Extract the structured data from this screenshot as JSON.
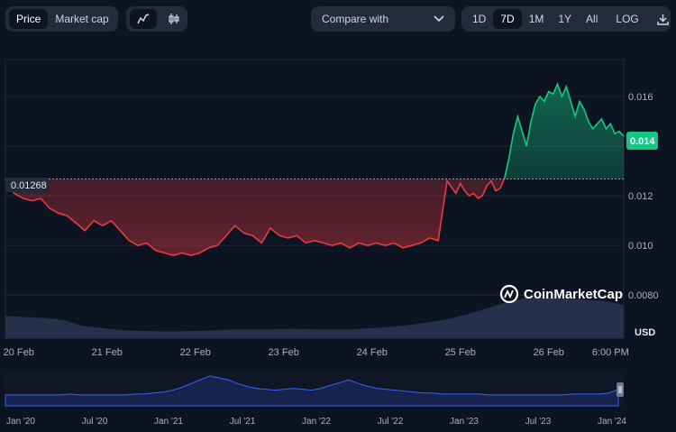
{
  "toolbar": {
    "tabs": [
      {
        "label": "Price",
        "active": true
      },
      {
        "label": "Market cap",
        "active": false
      }
    ],
    "chart_types": [
      "line-chart-icon",
      "candlestick-icon"
    ],
    "compare": {
      "label": "Compare with",
      "icon": "chevron-down-icon"
    },
    "ranges": [
      {
        "label": "1D",
        "active": false
      },
      {
        "label": "7D",
        "active": true
      },
      {
        "label": "1M",
        "active": false
      },
      {
        "label": "1Y",
        "active": false
      },
      {
        "label": "All",
        "active": false
      }
    ],
    "scale_label": "LOG",
    "download_icon": "download-icon"
  },
  "watermark": {
    "text": "CoinMarketCap",
    "icon": "coinmarketcap-logo"
  },
  "colors": {
    "up": "#16c784",
    "down": "#ea3943",
    "volume": "#2b3552",
    "nav_line": "#3861fb",
    "background": "#0d1421"
  },
  "chart_data": {
    "type": "area",
    "currency": "USD",
    "baseline": 0.01268,
    "baseline_label": "0.01268",
    "current_label": "0.014",
    "y_ticks": [
      "0.016",
      "0.014",
      "0.012",
      "0.010",
      "0.0080"
    ],
    "y_tick_values": [
      0.016,
      0.014,
      0.012,
      0.01,
      0.008
    ],
    "ylim": [
      0.0079,
      0.0172
    ],
    "x_ticks": [
      "20 Feb",
      "21 Feb",
      "22 Feb",
      "23 Feb",
      "24 Feb",
      "25 Feb",
      "26 Feb",
      "6:00 PM"
    ],
    "x_tick_values": [
      0.15,
      1.15,
      2.15,
      3.15,
      4.15,
      5.15,
      6.15,
      6.85
    ],
    "xlim": [
      0.0,
      7.0
    ],
    "price": {
      "x": [
        0.0,
        0.05,
        0.1,
        0.2,
        0.3,
        0.4,
        0.5,
        0.6,
        0.7,
        0.8,
        0.9,
        1.0,
        1.1,
        1.2,
        1.3,
        1.4,
        1.5,
        1.6,
        1.7,
        1.8,
        1.9,
        2.0,
        2.1,
        2.2,
        2.3,
        2.4,
        2.5,
        2.6,
        2.7,
        2.8,
        2.9,
        3.0,
        3.1,
        3.2,
        3.3,
        3.4,
        3.5,
        3.6,
        3.7,
        3.8,
        3.9,
        4.0,
        4.1,
        4.2,
        4.3,
        4.4,
        4.5,
        4.6,
        4.7,
        4.8,
        4.9,
        5.0,
        5.1,
        5.15,
        5.2,
        5.25,
        5.3,
        5.35,
        5.4,
        5.45,
        5.5,
        5.55,
        5.6,
        5.65,
        5.7,
        5.75,
        5.8,
        5.85,
        5.9,
        5.95,
        6.0,
        6.05,
        6.1,
        6.15,
        6.2,
        6.25,
        6.3,
        6.35,
        6.4,
        6.45,
        6.5,
        6.55,
        6.6,
        6.65,
        6.7,
        6.75,
        6.8,
        6.85,
        6.9,
        6.95,
        7.0
      ],
      "y": [
        0.01268,
        0.0124,
        0.0121,
        0.0119,
        0.0118,
        0.0119,
        0.0115,
        0.0113,
        0.0112,
        0.0109,
        0.0106,
        0.011,
        0.0108,
        0.011,
        0.0106,
        0.0102,
        0.01,
        0.0101,
        0.0098,
        0.0097,
        0.0096,
        0.0097,
        0.0096,
        0.0097,
        0.0099,
        0.01,
        0.0104,
        0.0108,
        0.0105,
        0.0104,
        0.0101,
        0.0107,
        0.0104,
        0.0103,
        0.0104,
        0.0101,
        0.0102,
        0.0101,
        0.01,
        0.0101,
        0.0099,
        0.0101,
        0.01,
        0.0101,
        0.01,
        0.0101,
        0.0099,
        0.01,
        0.0101,
        0.0103,
        0.0102,
        0.0126,
        0.0121,
        0.0125,
        0.0122,
        0.012,
        0.0121,
        0.0119,
        0.012,
        0.0124,
        0.0126,
        0.0122,
        0.0123,
        0.0127,
        0.0135,
        0.0145,
        0.0152,
        0.0146,
        0.014,
        0.015,
        0.0157,
        0.016,
        0.0158,
        0.0162,
        0.0161,
        0.0165,
        0.016,
        0.0164,
        0.0158,
        0.0152,
        0.0158,
        0.0155,
        0.015,
        0.0147,
        0.0149,
        0.0151,
        0.0147,
        0.0149,
        0.0145,
        0.0146,
        0.0144
      ]
    },
    "volume_relative": [
      0.55,
      0.52,
      0.5,
      0.45,
      0.3,
      0.25,
      0.2,
      0.18,
      0.17,
      0.17,
      0.18,
      0.2,
      0.22,
      0.22,
      0.22,
      0.23,
      0.22,
      0.22,
      0.22,
      0.25,
      0.28,
      0.33,
      0.4,
      0.48,
      0.6,
      0.75,
      0.9,
      1.0,
      1.0,
      0.98,
      0.95,
      0.92,
      0.82
    ]
  },
  "navigator": {
    "labels": [
      "Jan '20",
      "Jul '20",
      "Jan '21",
      "Jul '21",
      "Jan '22",
      "Jul '22",
      "Jan '23",
      "Jul '23",
      "Jan '24"
    ],
    "handle_icon": "range-handle-icon"
  }
}
